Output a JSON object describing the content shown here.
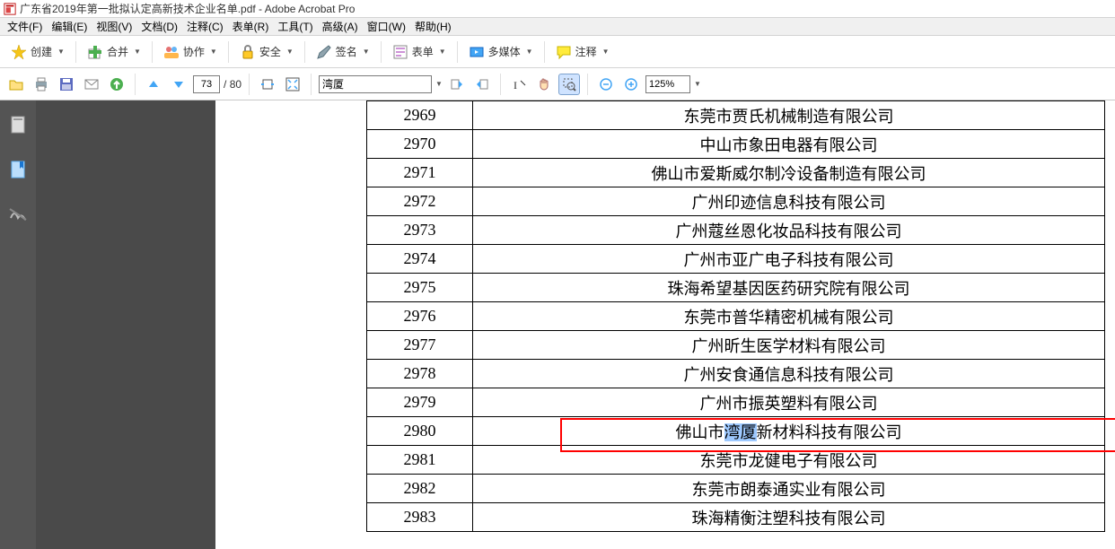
{
  "titlebar": {
    "title": "广东省2019年第一批拟认定高新技术企业名单.pdf - Adobe Acrobat Pro"
  },
  "menu": {
    "file": "文件(F)",
    "edit": "编辑(E)",
    "view": "视图(V)",
    "document": "文档(D)",
    "comment": "注释(C)",
    "form": "表单(R)",
    "tools": "工具(T)",
    "advanced": "高级(A)",
    "window": "窗口(W)",
    "help": "帮助(H)"
  },
  "toolbar1": {
    "create": "创建",
    "merge": "合并",
    "collab": "协作",
    "security": "安全",
    "sign": "签名",
    "form": "表单",
    "media": "多媒体",
    "comment": "注释"
  },
  "nav": {
    "page_current": "73",
    "page_sep": "/",
    "page_total": "80",
    "search_value": "湾厦",
    "zoom_value": "125%"
  },
  "table_rows": [
    {
      "num": "2969",
      "name": "东莞市贾氏机械制造有限公司"
    },
    {
      "num": "2970",
      "name": "中山市象田电器有限公司"
    },
    {
      "num": "2971",
      "name": "佛山市爱斯威尔制冷设备制造有限公司"
    },
    {
      "num": "2972",
      "name": "广州印迹信息科技有限公司"
    },
    {
      "num": "2973",
      "name": "广州蔻丝恩化妆品科技有限公司"
    },
    {
      "num": "2974",
      "name": "广州市亚广电子科技有限公司"
    },
    {
      "num": "2975",
      "name": "珠海希望基因医药研究院有限公司"
    },
    {
      "num": "2976",
      "name": "东莞市普华精密机械有限公司"
    },
    {
      "num": "2977",
      "name": "广州昕生医学材料有限公司"
    },
    {
      "num": "2978",
      "name": "广州安食通信息科技有限公司"
    },
    {
      "num": "2979",
      "name": "广州市振英塑料有限公司"
    },
    {
      "num": "2980",
      "name_pre": "佛山市",
      "name_sel": "湾厦",
      "name_post": "新材料科技有限公司",
      "highlighted": true
    },
    {
      "num": "2981",
      "name": "东莞市龙健电子有限公司"
    },
    {
      "num": "2982",
      "name": "东莞市朗泰通实业有限公司"
    },
    {
      "num": "2983",
      "name": "珠海精衡注塑科技有限公司"
    }
  ]
}
